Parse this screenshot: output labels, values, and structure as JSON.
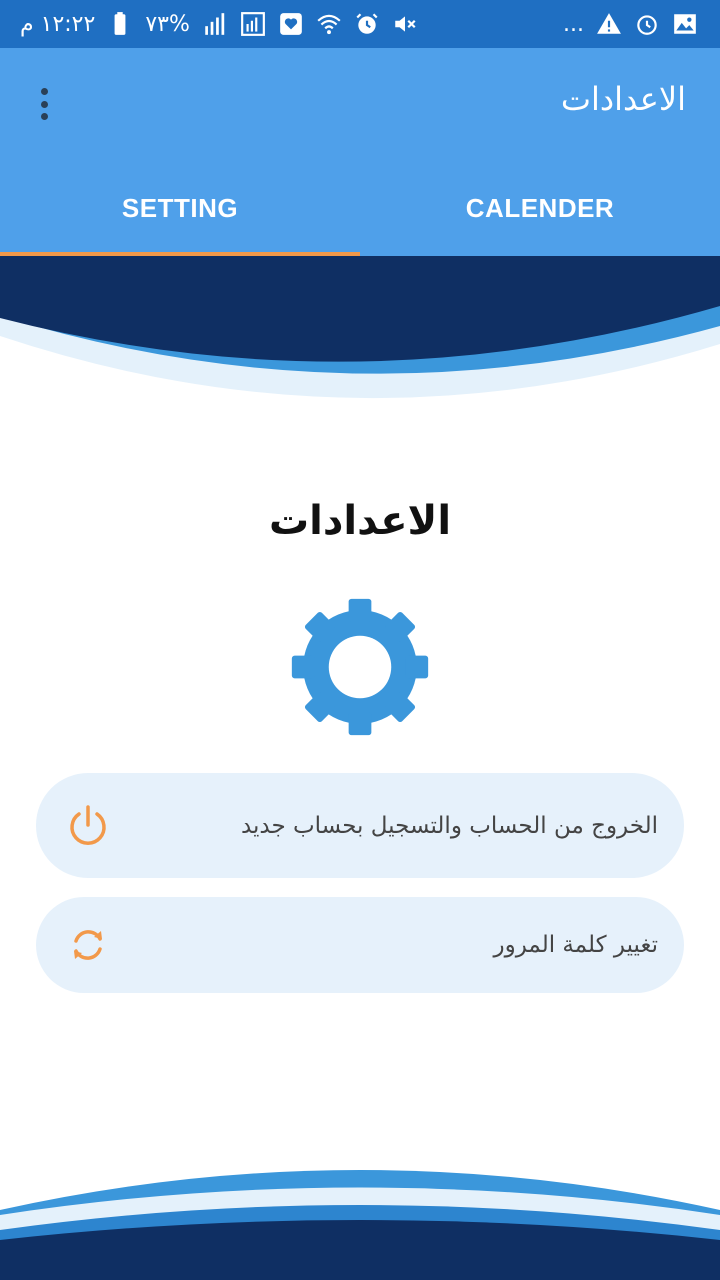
{
  "status_bar": {
    "time": "١٢:٢٢ م",
    "battery": "%٧٣",
    "more": "...",
    "icons_left": [
      "battery-icon",
      "signal-icon",
      "data-icon",
      "heart-notification-icon",
      "wifi-icon",
      "alarm-icon",
      "mute-icon"
    ],
    "icons_right": [
      "ellipsis",
      "warning-icon",
      "clock-icon",
      "image-icon"
    ]
  },
  "app_bar": {
    "title": "الاعدادات",
    "menu_icon": "more-vertical-icon"
  },
  "tabs": [
    {
      "label": "SETTING",
      "active": true
    },
    {
      "label": "CALENDER",
      "active": false
    }
  ],
  "content": {
    "heading": "الاعدادات",
    "heading_icon": "gear-icon"
  },
  "options": [
    {
      "label": "الخروج من الحساب والتسجيل بحساب جديد",
      "icon": "power-icon"
    },
    {
      "label": "تغيير كلمة المرور",
      "icon": "sync-icon"
    }
  ],
  "colors": {
    "status_bar": "#1f6fc2",
    "app_bar": "#4fa0ea",
    "tab_indicator": "#f2994a",
    "navy": "#0f2f63",
    "gear": "#3b97db",
    "option_bg": "#e6f1fb",
    "icon_orange": "#f2994a"
  }
}
